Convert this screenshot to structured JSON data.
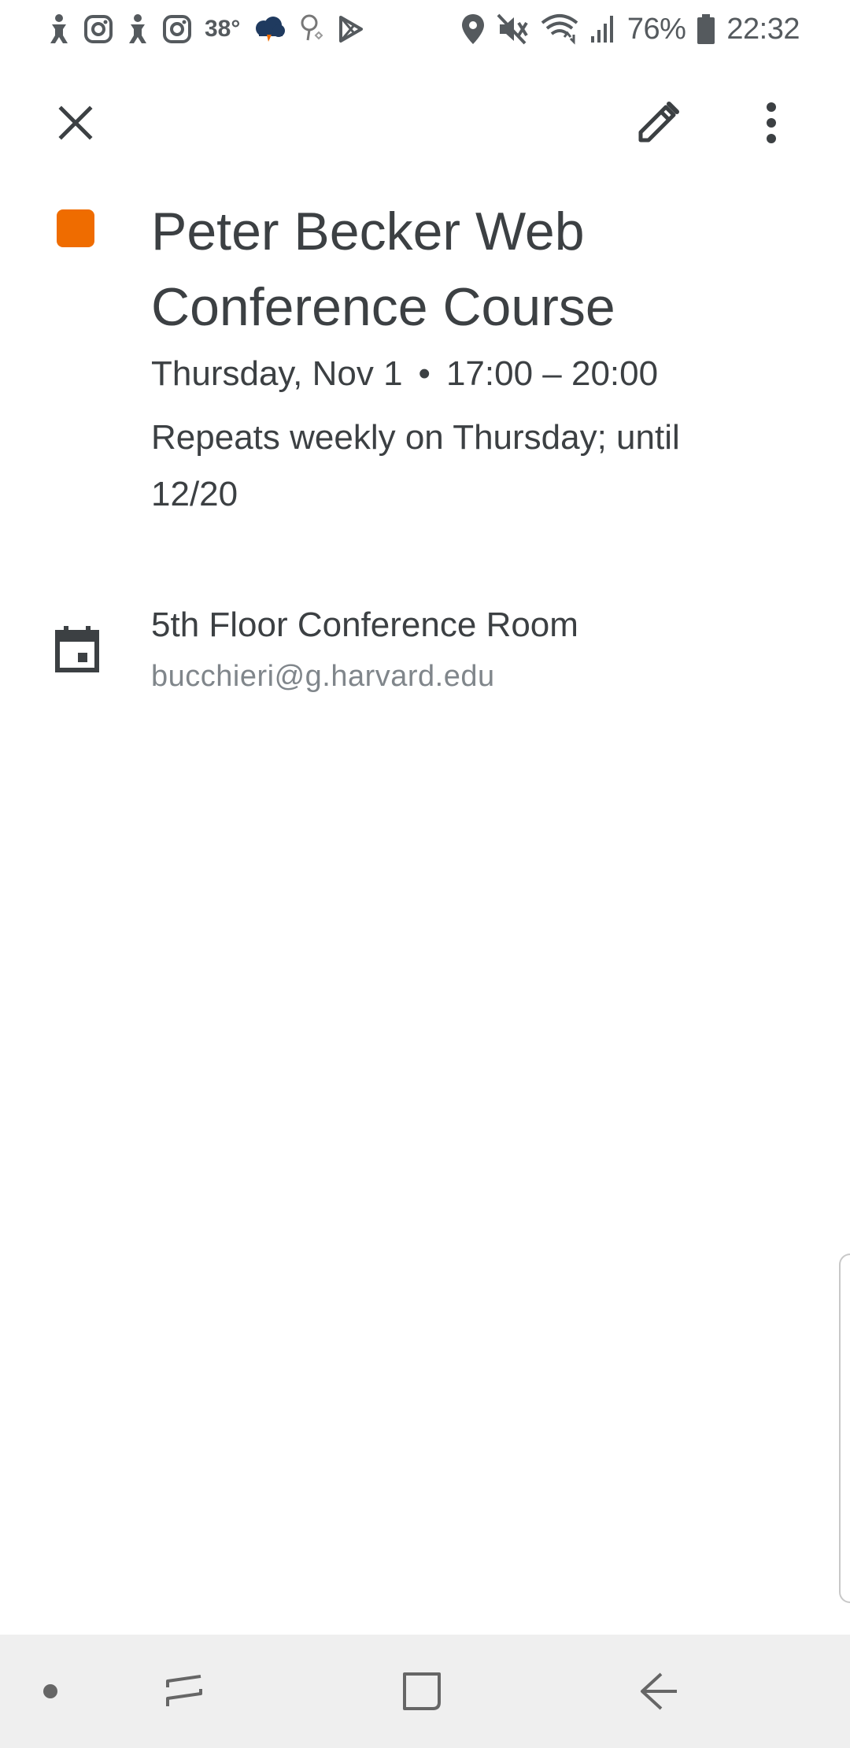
{
  "status_bar": {
    "temperature": "38°",
    "battery_percent": "76%",
    "time": "22:32",
    "icons_left": [
      "accessibility-icon",
      "instagram-icon",
      "accessibility-icon",
      "instagram-icon",
      "weather-icon",
      "app-notification-icon",
      "play-store-icon"
    ],
    "icons_right": [
      "location-icon",
      "mute-icon",
      "wifi-icon",
      "signal-icon",
      "battery-icon"
    ]
  },
  "toolbar": {
    "close_icon": "close-icon",
    "edit_icon": "pencil-icon",
    "more_icon": "more-vert-icon"
  },
  "event": {
    "color": "#ef6c00",
    "title": "Peter Becker Web Conference Course",
    "date": "Thursday, Nov 1",
    "separator": "•",
    "time_range": "17:00 – 20:00",
    "recurrence": "Repeats weekly on Thursday; until 12/20"
  },
  "calendar": {
    "icon": "calendar-icon",
    "name": "5th Floor Conference Room",
    "owner": "bucchieri@g.harvard.edu"
  },
  "nav_bar": {
    "buttons": [
      "dot-icon",
      "recents-icon",
      "home-icon",
      "back-icon"
    ]
  }
}
